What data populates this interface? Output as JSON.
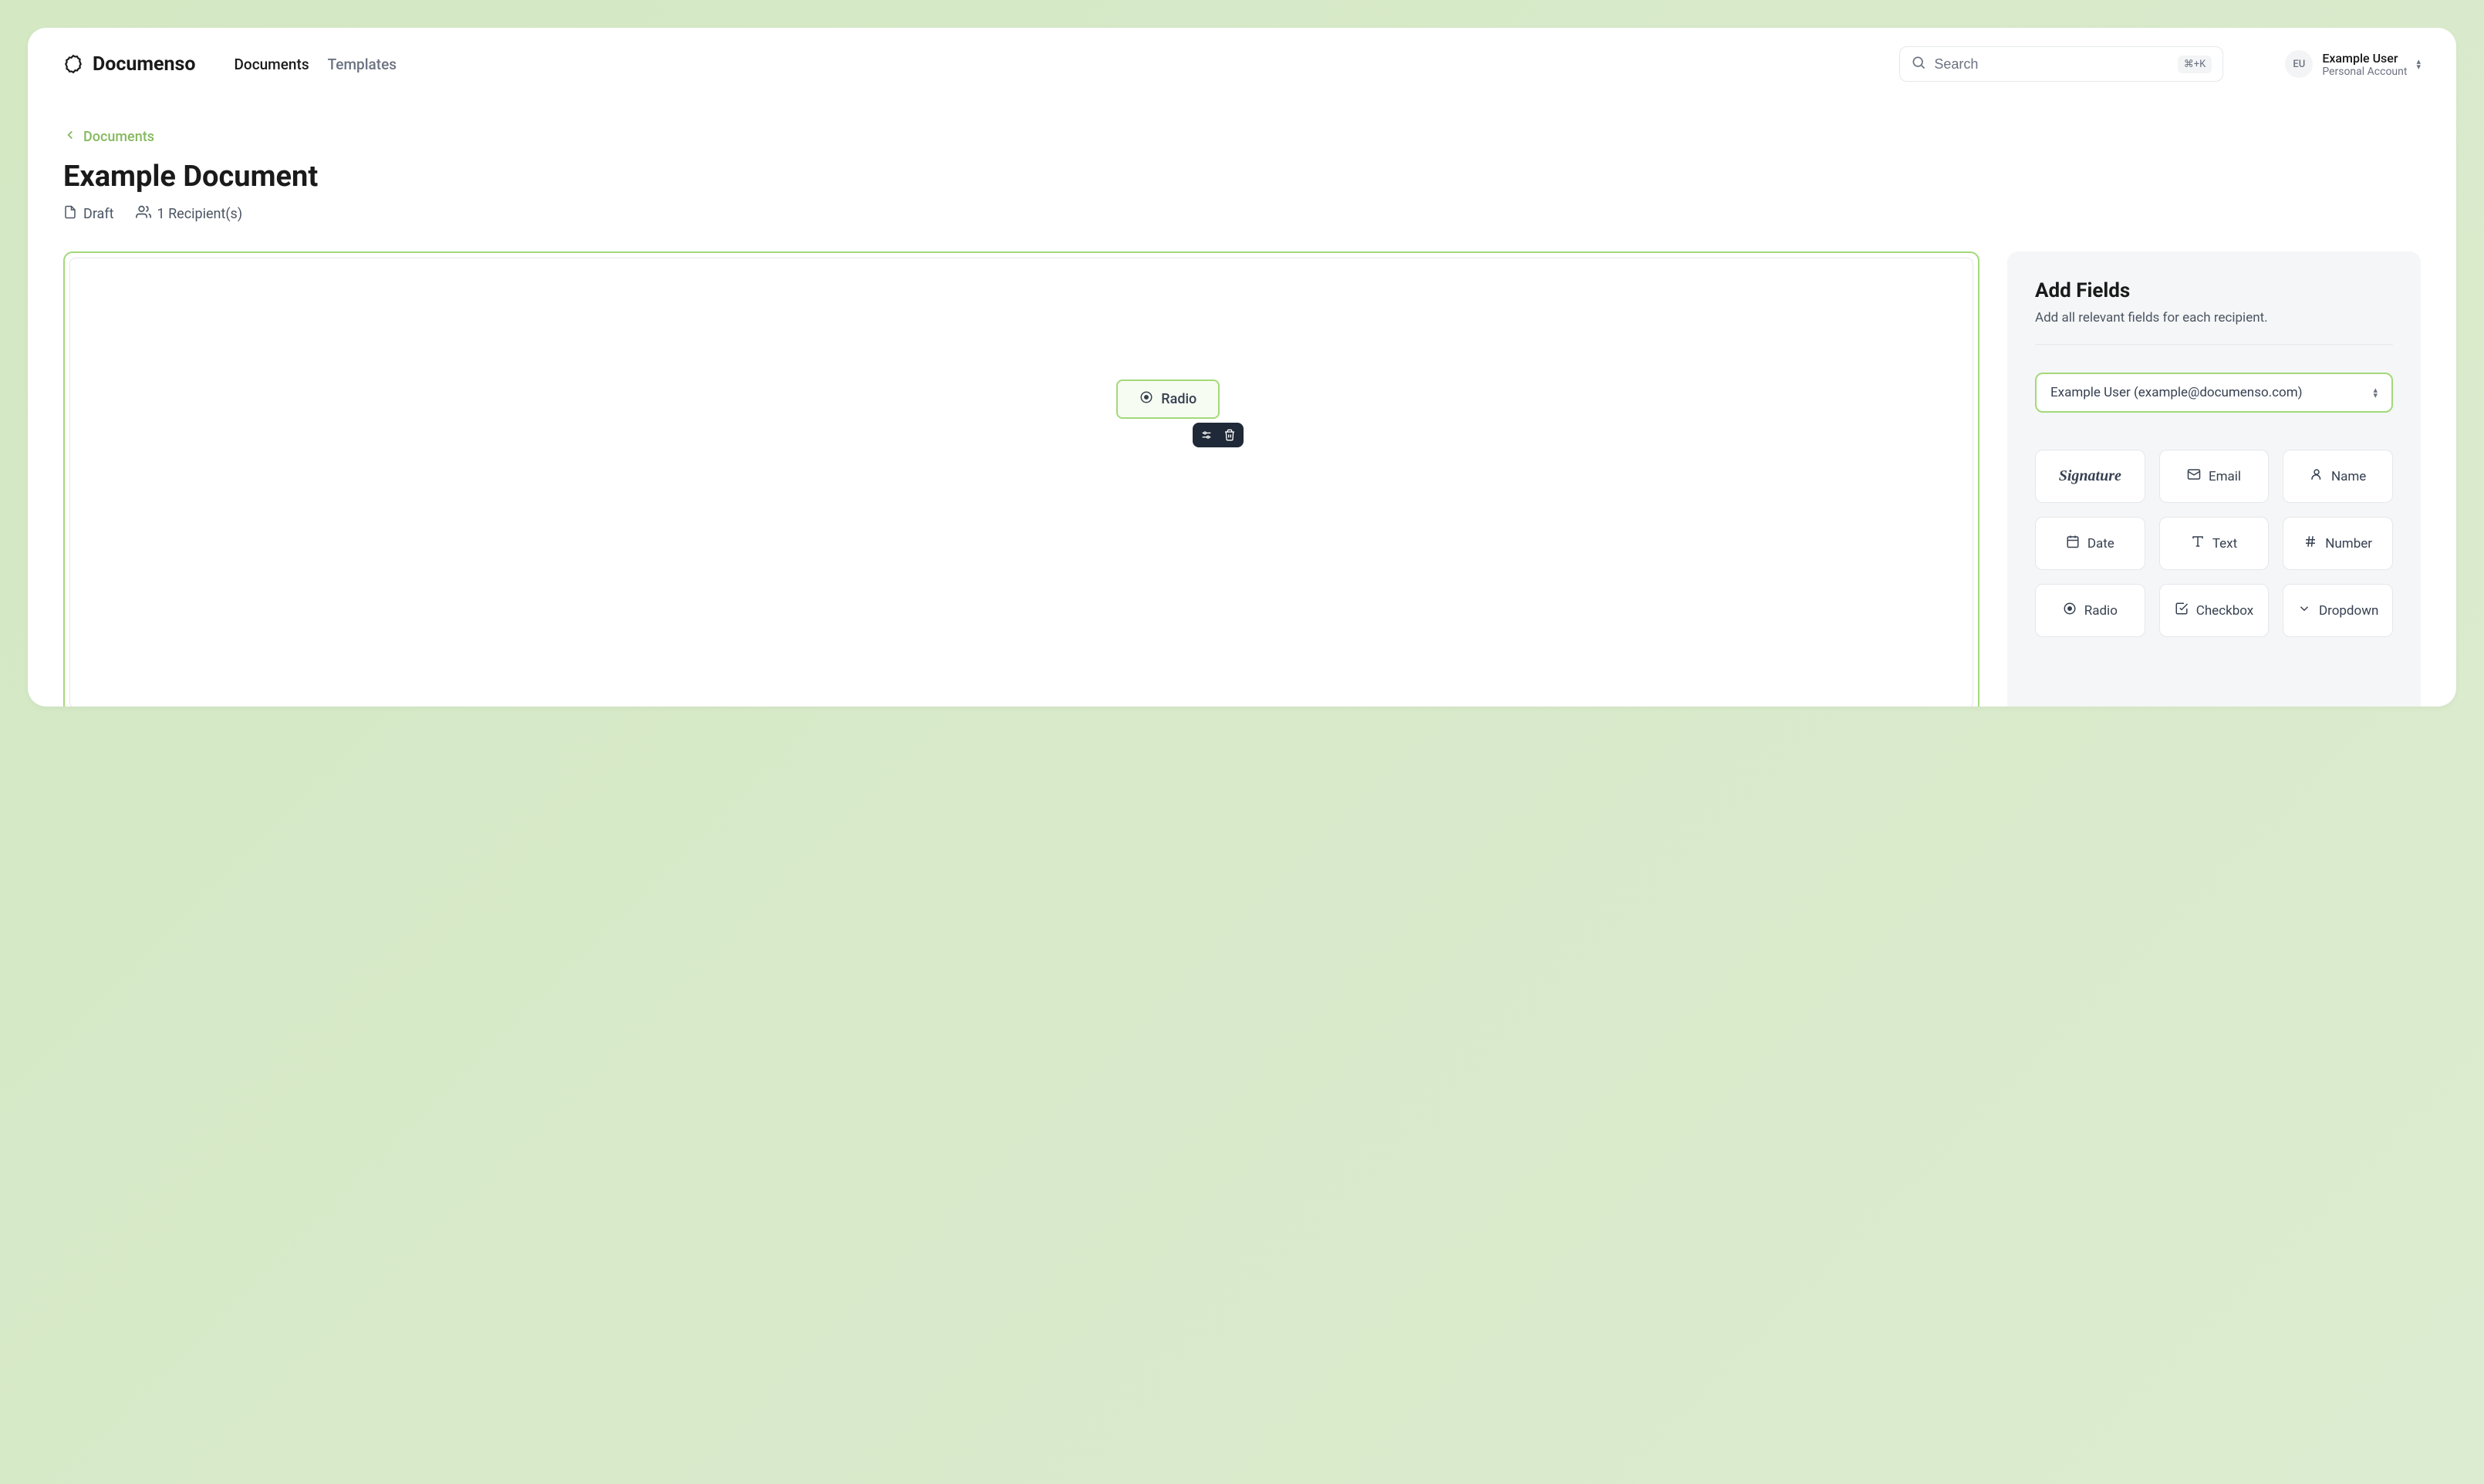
{
  "header": {
    "logo_text": "Documenso",
    "nav": {
      "documents": "Documents",
      "templates": "Templates"
    },
    "search_placeholder": "Search",
    "search_kbd": "⌘+K",
    "avatar_initials": "EU",
    "user_name": "Example User",
    "user_sub": "Personal Account"
  },
  "breadcrumb": "Documents",
  "page_title": "Example Document",
  "meta": {
    "status": "Draft",
    "recipients": "1 Recipient(s)"
  },
  "canvas": {
    "field_label": "Radio"
  },
  "sidebar": {
    "title": "Add Fields",
    "subtitle": "Add all relevant fields for each recipient.",
    "recipient": "Example User (example@documenso.com)",
    "fields": {
      "signature": "Signature",
      "email": "Email",
      "name": "Name",
      "date": "Date",
      "text": "Text",
      "number": "Number",
      "radio": "Radio",
      "checkbox": "Checkbox",
      "dropdown": "Dropdown"
    }
  }
}
